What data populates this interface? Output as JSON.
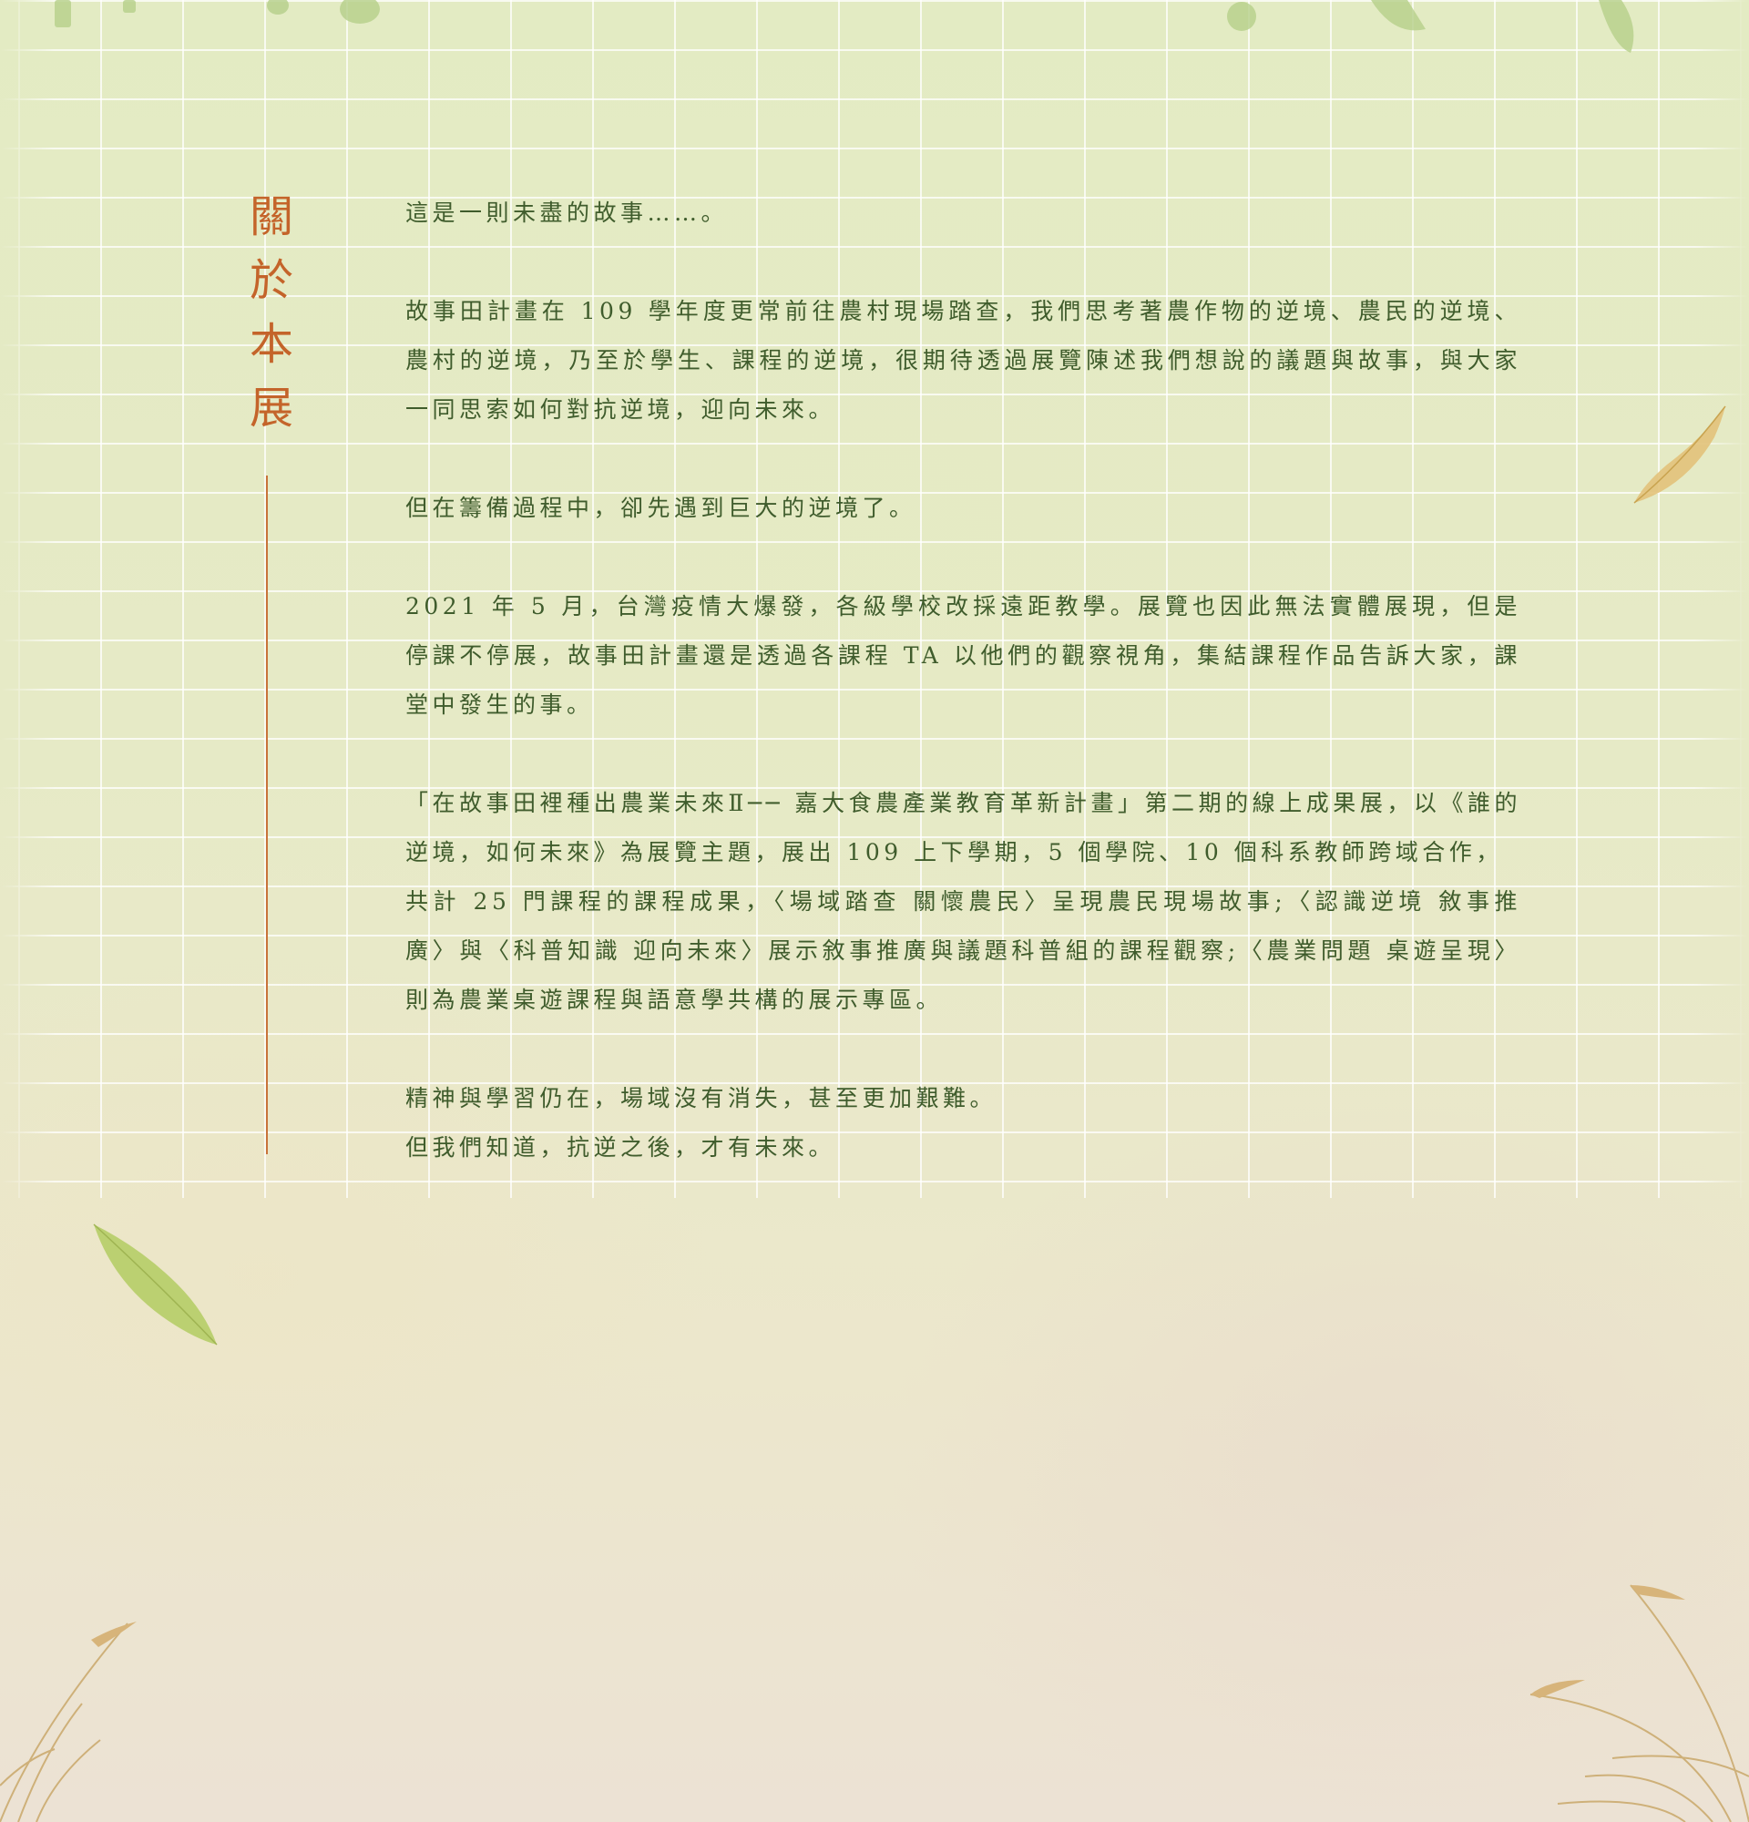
{
  "section": {
    "title": "關於本展"
  },
  "paragraphs": [
    "這是一則未盡的故事……。",
    "故事田計畫在 109 學年度更常前往農村現場踏查，我們思考著農作物的逆境、農民的逆境、農村的逆境，乃至於學生、課程的逆境，很期待透過展覽陳述我們想說的議題與故事，與大家一同思索如何對抗逆境，迎向未來。",
    "但在籌備過程中，卻先遇到巨大的逆境了。",
    "2021 年 5 月，台灣疫情大爆發，各級學校改採遠距教學。展覽也因此無法實體展現，但是停課不停展，故事田計畫還是透過各課程 TA 以他們的觀察視角，集結課程作品告訴大家，課堂中發生的事。",
    "「在故事田裡種出農業未來Ⅱ── 嘉大食農產業教育革新計畫」第二期的線上成果展，以《誰的逆境，如何未來》為展覽主題，展出 109 上下學期，5 個學院、10 個科系教師跨域合作，\n共計 25 門課程的課程成果，〈場域踏查 關懷農民〉呈現農民現場故事;〈認識逆境 敘事推廣〉與〈科普知識 迎向未來〉展示敘事推廣與議題科普組的課程觀察;〈農業問題 桌遊呈現〉則為農業桌遊課程與語意學共構的展示專區。",
    "精神與學習仍在，場域沒有消失，甚至更加艱難。\n但我們知道，抗逆之後，才有未來。"
  ],
  "colors": {
    "title": "#c4642a",
    "text": "#3f5c2c",
    "accent_line": "#c8733a"
  }
}
